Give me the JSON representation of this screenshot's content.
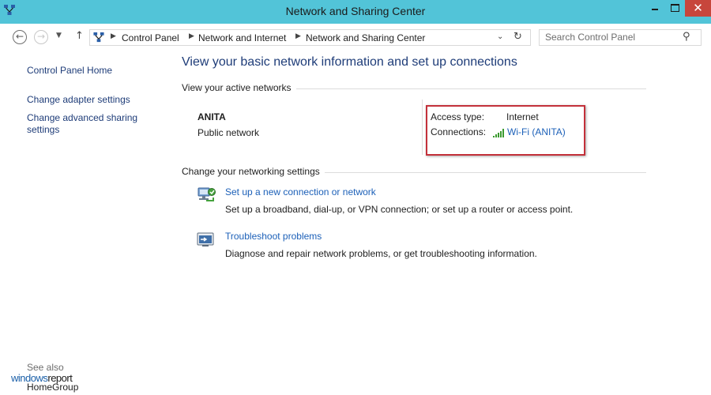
{
  "window": {
    "title": "Network and Sharing Center",
    "controls": {
      "minimize": "minimize",
      "maximize": "maximize",
      "close": "✕"
    }
  },
  "address_bar": {
    "breadcrumbs": [
      "Control Panel",
      "Network and Internet",
      "Network and Sharing Center"
    ],
    "search_placeholder": "Search Control Panel"
  },
  "left_pane": {
    "home_link": "Control Panel Home",
    "links": [
      "Change adapter settings",
      "Change advanced sharing settings"
    ],
    "see_also": {
      "heading": "See also",
      "items": [
        "HomeGroup"
      ]
    }
  },
  "main": {
    "title": "View your basic network information and set up connections",
    "active_networks": {
      "heading": "View your active networks",
      "network_name": "ANITA",
      "network_type": "Public network",
      "access_type_label": "Access type:",
      "access_type_value": "Internet",
      "connections_label": "Connections:",
      "connection_link": "Wi-Fi (ANITA)"
    },
    "networking_settings": {
      "heading": "Change your networking settings",
      "tasks": [
        {
          "icon": "network-setup-icon",
          "link": "Set up a new connection or network",
          "description": "Set up a broadband, dial-up, or VPN connection; or set up a router or access point."
        },
        {
          "icon": "troubleshoot-icon",
          "link": "Troubleshoot problems",
          "description": "Diagnose and repair network problems, or get troubleshooting information."
        }
      ]
    }
  },
  "watermark": {
    "part1": "windows",
    "part2": "report"
  },
  "colors": {
    "titlebar": "#52c4d8",
    "close_button": "#c7463c",
    "link": "#1c60b8",
    "highlight_border": "#c3303a",
    "heading": "#1e3c78"
  }
}
